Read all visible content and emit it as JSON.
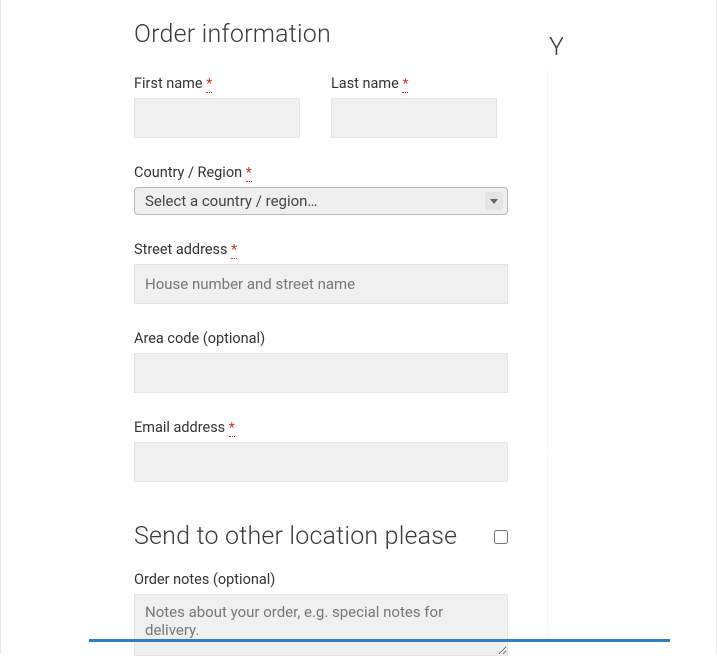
{
  "billing": {
    "heading": "Order information",
    "first_name": {
      "label": "First name",
      "required": "*",
      "value": ""
    },
    "last_name": {
      "label": "Last name",
      "required": "*",
      "value": ""
    },
    "country": {
      "label": "Country / Region",
      "required": "*",
      "selected": "Select a country / region…"
    },
    "street": {
      "label": "Street address",
      "required": "*",
      "placeholder": "House number and street name",
      "value": ""
    },
    "area_code": {
      "label": "Area code (optional)",
      "value": ""
    },
    "email": {
      "label": "Email address",
      "required": "*",
      "value": ""
    }
  },
  "shipping": {
    "heading": "Send to other location please",
    "checked": false,
    "order_notes": {
      "label": "Order notes (optional)",
      "placeholder": "Notes about your order, e.g. special notes for delivery.",
      "value": ""
    }
  },
  "side_heading": "Y"
}
